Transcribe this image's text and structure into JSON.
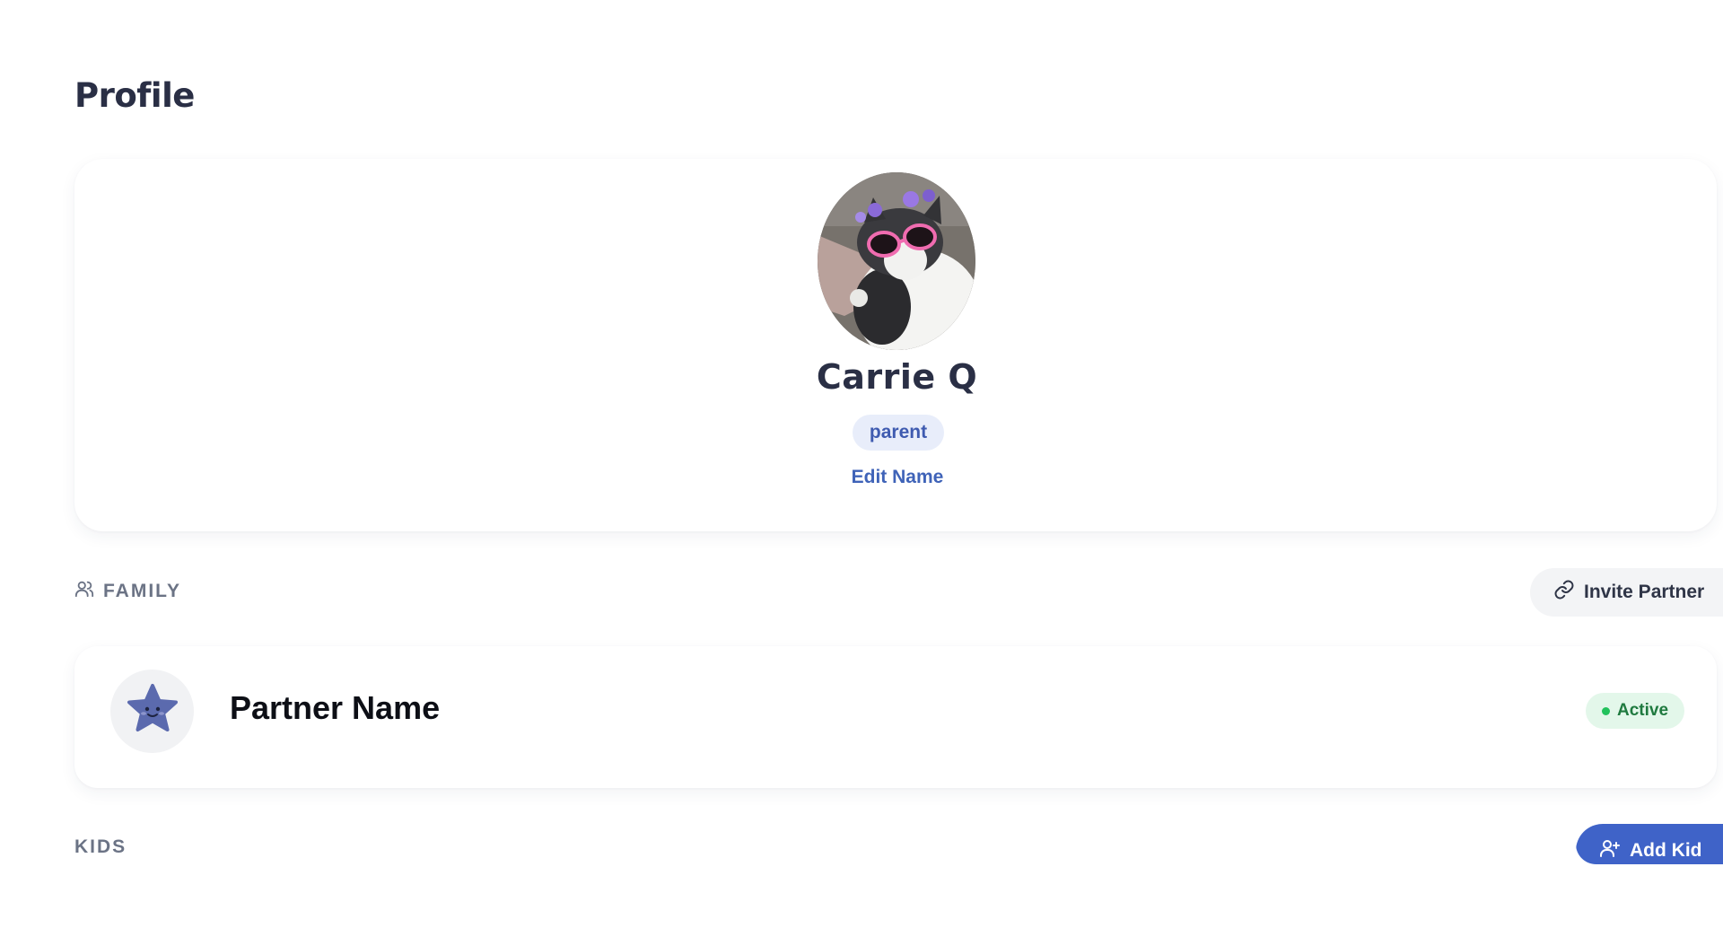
{
  "page": {
    "title": "Profile"
  },
  "profile": {
    "name": "Carrie Q",
    "role": "parent",
    "edit_label": "Edit Name",
    "avatar_icon": "cat-photo-avatar"
  },
  "family": {
    "section_label": "FAMILY",
    "section_icon": "users-icon",
    "invite_label": "Invite Partner",
    "invite_icon": "link-icon",
    "partner": {
      "name": "Partner Name",
      "avatar_icon": "star-icon",
      "status": "Active"
    }
  },
  "kids": {
    "section_label": "KIDS",
    "add_label": "Add Kid",
    "add_icon": "user-plus-icon"
  },
  "colors": {
    "accent": "#3f63c8",
    "badge_bg": "#e8edfa",
    "active_green": "#22c25c"
  }
}
